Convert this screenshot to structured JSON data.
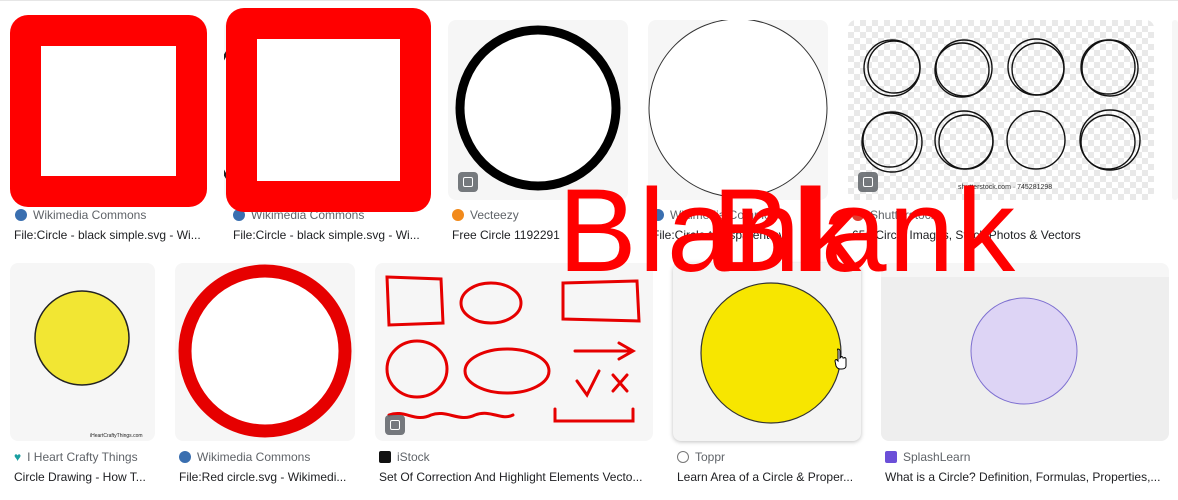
{
  "results": [
    {
      "source": "Wikimedia Commons",
      "title": "File:Circle - black simple.svg - Wi...",
      "icon": "wikimedia-icon"
    },
    {
      "source": "Wikimedia Commons",
      "title": "File:Circle - black simple.svg - Wi...",
      "icon": "wikimedia-icon"
    },
    {
      "source": "Vecteezy",
      "title": "Free Circle 1192291",
      "icon": "vecteezy-icon"
    },
    {
      "source": "Wikimedia Commons",
      "title": "File:Circle transparent.svg",
      "icon": "wikimedia-icon"
    },
    {
      "source": "Shutterstock",
      "title": "651 Circle Images, Stock Photos & Vectors",
      "watermark": "shutterstock.com · 745281298",
      "icon": "shutterstock-icon"
    },
    {
      "source": "I Heart Crafty Things",
      "title": "Circle Drawing - How T...",
      "watermark": "iHeartCraftyThings.com",
      "icon": "heart-icon"
    },
    {
      "source": "Wikimedia Commons",
      "title": "File:Red circle.svg - Wikimedi...",
      "icon": "wikimedia-icon"
    },
    {
      "source": "iStock",
      "title": "Set Of Correction And Highlight Elements Vecto...",
      "icon": "istock-icon"
    },
    {
      "source": "Toppr",
      "title": "Learn Area of a Circle & Proper...",
      "icon": "toppr-icon"
    },
    {
      "source": "SplashLearn",
      "title": "What is a Circle? Definition, Formulas, Properties,...",
      "icon": "splashlearn-icon"
    }
  ],
  "overlays": {
    "text_a": "Blank",
    "text_b": "Blank"
  },
  "colors": {
    "overlay_red": "#ff0000",
    "yellow": "#f2e633",
    "bright_yellow": "#f7e600",
    "lavender": "#ddd4f5",
    "circle_red": "#e60000"
  }
}
